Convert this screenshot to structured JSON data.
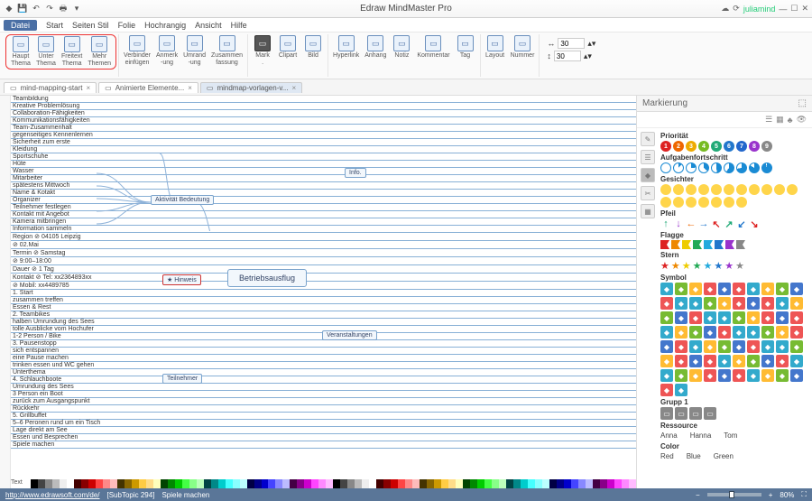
{
  "title": "Edraw MindMaster Pro",
  "user": "juliamind",
  "menu": {
    "datei": "Datei",
    "items": [
      "Start",
      "Seiten Stil",
      "Folie",
      "Hochrangig",
      "Ansicht",
      "Hilfe"
    ]
  },
  "ribbon": {
    "g1": [
      {
        "l": "Haupt\nThema",
        "n": "haupt-thema"
      },
      {
        "l": "Unter\nThema",
        "n": "unter-thema"
      },
      {
        "l": "Freitext\nThema",
        "n": "freitext-thema"
      },
      {
        "l": "Mehr\nThemen",
        "n": "mehr-themen"
      }
    ],
    "g2": [
      {
        "l": "Verbinder\neinfügen",
        "n": "verbinder"
      },
      {
        "l": "Anmerk\n-ung",
        "n": "anmerkung"
      },
      {
        "l": "Umrand\n-ung",
        "n": "umrandung"
      },
      {
        "l": "Zusammen\nfassung",
        "n": "zusammenfassung"
      }
    ],
    "g3": [
      {
        "l": "Mark\n.",
        "n": "mark"
      },
      {
        "l": "Clipart",
        "n": "clipart"
      },
      {
        "l": "Bild",
        "n": "bild"
      }
    ],
    "g4": [
      {
        "l": "Hyperlink",
        "n": "hyperlink"
      },
      {
        "l": "Anhang",
        "n": "anhang"
      },
      {
        "l": "Notiz",
        "n": "notiz"
      },
      {
        "l": "Kommentar",
        "n": "kommentar"
      },
      {
        "l": "Tag",
        "n": "tag"
      }
    ],
    "g5": [
      {
        "l": "Layout",
        "n": "layout"
      },
      {
        "l": "Nummer",
        "n": "nummer"
      }
    ],
    "num1": "30",
    "num2": "30"
  },
  "tabs": [
    {
      "l": "mind-mapping-start",
      "a": false
    },
    {
      "l": "Animierte Elemente...",
      "a": false
    },
    {
      "l": "mindmap-vorlagen-v...",
      "a": true
    }
  ],
  "mindmap": {
    "central": "Betriebsausflug",
    "branches_left": [
      {
        "label": "Aktivität Bedeutung",
        "children": [
          "Teambildung",
          "Kreative Problemlösung",
          "Collaboration-Fähigkeiten",
          "Kommunikationsfähigkeiten",
          "Team-Zusammenhalt",
          "gegenseitiges Kennenlernen"
        ]
      },
      {
        "label": "Hinweis",
        "badge": "star",
        "children": [
          "Sicherheit zum erste",
          "Kleidung",
          "Sportschuhe",
          "Hüte",
          "Wasser"
        ]
      },
      {
        "label": "Teilnehmer",
        "children": [
          {
            "label": "Mitarbeiter",
            "children": [
              "spätestens Mittwoch",
              "Name & Kotakt"
            ]
          },
          {
            "label": "Organizer",
            "children": [
              "Teilnehmer festlegen",
              "Kontakt mit Angebot",
              "Kamera mitbringen",
              "Information sammeln"
            ]
          }
        ]
      }
    ],
    "branches_right": [
      {
        "label": "Info.",
        "children": [
          {
            "k": "Region",
            "v": "04105 Leipzig"
          },
          {
            "k": "",
            "v": "02.Mai"
          },
          {
            "k": "Termin",
            "v": "Samstag"
          },
          {
            "k": "",
            "v": "9:00–18:00"
          },
          {
            "k": "Dauer",
            "v": "1 Tag"
          },
          {
            "k": "Kontakt",
            "v": "Tel: xx2364893xx"
          },
          {
            "k": "",
            "v": "Mobil: xx4489785"
          }
        ]
      },
      {
        "label": "Veranstaltungen",
        "children": [
          {
            "label": "1. Start",
            "children": [
              "zusammen treffen",
              "Essen & Rest"
            ]
          },
          {
            "label": "2. Teambikes",
            "children": [
              "halben Umrundung des Sees",
              "tolle Ausblicke vom Hochufer",
              "1-2 Person / Bike"
            ]
          },
          {
            "label": "3. Pausenstopp",
            "children": [
              "sich entspannen",
              "eine Pause machen",
              "trinken essen und WC gehen",
              "Unterthema"
            ]
          },
          {
            "label": "4. Schlauchboote",
            "children": [
              "Umrundung des Sees",
              "3 Person ein Boot",
              "zurück zum Ausgangspunkt"
            ],
            "aside": "Rückkehr"
          },
          {
            "label": "5. Grillbuffet",
            "children": [
              "5–6 Peronen rund um ein Tisch",
              "Lage direkt am See",
              "Essen und Besprechen",
              "Spiele machen"
            ]
          }
        ]
      }
    ]
  },
  "panel": {
    "title": "Markierung",
    "sections": {
      "prioritaet": "Priorität",
      "aufgaben": "Aufgabenfortschritt",
      "gesichter": "Gesichter",
      "pfeil": "Pfeil",
      "flagge": "Flagge",
      "stern": "Stern",
      "symbol": "Symbol",
      "grupp": "Grupp 1",
      "ressource": "Ressource",
      "color": "Color"
    },
    "ressource_items": [
      "Anna",
      "Hanna",
      "Tom"
    ],
    "color_items": [
      "Red",
      "Blue",
      "Green"
    ]
  },
  "status": {
    "url": "http://www.edrawsoft.com/de/",
    "topic": "[SubTopic 294]",
    "sel": "Spiele machen",
    "zoom": "80%"
  },
  "text_label": "Text"
}
